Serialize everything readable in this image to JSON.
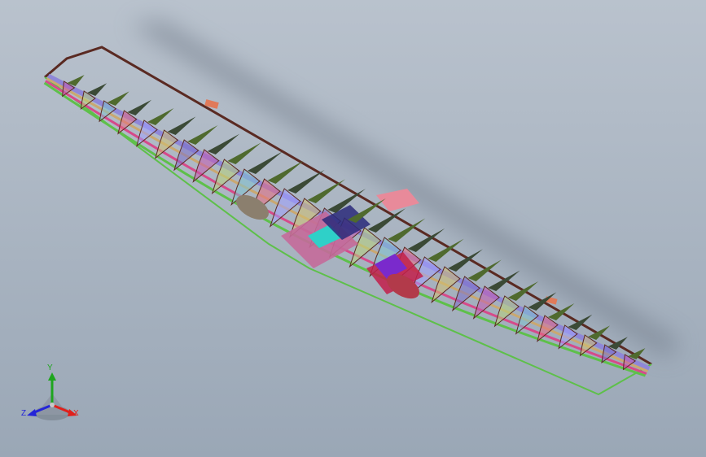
{
  "triad": {
    "y_label": "Y",
    "z_label": "Z",
    "x_label": "X",
    "colors": {
      "x": "#e0201c",
      "y": "#1ea51e",
      "z": "#2424d8"
    }
  },
  "model": {
    "frame_color": "#5a2a22",
    "spar_colors": [
      "#8f87d8",
      "#caa870",
      "#d64a8a",
      "#5ec04a"
    ],
    "rib_colors": [
      "#7c6fc8",
      "#c45ab0",
      "#b8d27a",
      "#7fc3d0",
      "#e86a7e",
      "#a0a0ff",
      "#d2c070"
    ]
  },
  "scene": {
    "background_top": "#b9c2cd",
    "background_bottom": "#9aa7b6"
  }
}
